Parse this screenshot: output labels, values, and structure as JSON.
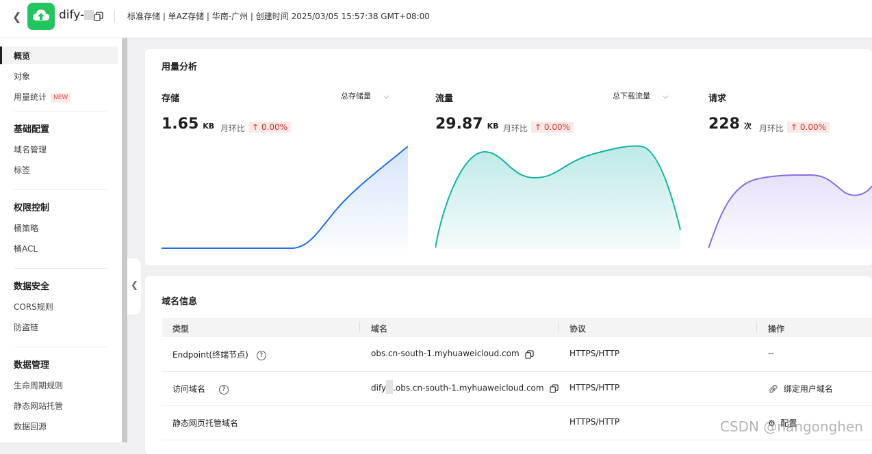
{
  "header": {
    "bucket_name": "dify-",
    "meta": "标准存储 | 单AZ存储 | 华南-广州 | 创建时间  2025/03/05 15:57:38 GMT+08:00"
  },
  "sidebar": {
    "overview": "概览",
    "objects": "对象",
    "usage_stats": "用量统计",
    "new_badge": "NEW",
    "groups": [
      {
        "title": "基础配置",
        "items": [
          "域名管理",
          "标签"
        ]
      },
      {
        "title": "权限控制",
        "items": [
          "桶策略",
          "桶ACL"
        ]
      },
      {
        "title": "数据安全",
        "items": [
          "CORS规则",
          "防盗链"
        ]
      },
      {
        "title": "数据管理",
        "items": [
          "生命周期规则",
          "静态网站托管",
          "数据回源"
        ]
      }
    ]
  },
  "usage": {
    "title": "用量分析",
    "metrics": [
      {
        "title": "存储",
        "select": "总存储量",
        "value": "1.65",
        "unit": "KB",
        "mom_label": "月环比",
        "mom": "↑ 0.00%"
      },
      {
        "title": "流量",
        "select": "总下载流量",
        "value": "29.87",
        "unit": "KB",
        "mom_label": "月环比",
        "mom": "↑ 0.00%"
      },
      {
        "title": "请求",
        "select": "",
        "value": "228",
        "unit": "次",
        "mom_label": "月环比",
        "mom": "↑ 0.00%"
      }
    ],
    "colors": {
      "storage": "#1e6fe8",
      "traffic": "#13b2a6",
      "requests": "#8b6be6"
    }
  },
  "domain": {
    "title": "域名信息",
    "columns": [
      "类型",
      "域名",
      "协议",
      "操作"
    ],
    "rows": [
      {
        "type": "Endpoint(终端节点)",
        "domain": "obs.cn-south-1.myhuaweicloud.com",
        "protocol": "HTTPS/HTTP",
        "action": "--"
      },
      {
        "type": "访问域名",
        "domain_prefix": "dify",
        "domain": ".obs.cn-south-1.myhuaweicloud.com",
        "protocol": "HTTPS/HTTP",
        "action": "绑定用户域名"
      },
      {
        "type": "静态网页托管域名",
        "domain": "",
        "protocol": "HTTPS/HTTP",
        "action": "配置"
      }
    ]
  },
  "watermark": "CSDN @nangonghen"
}
